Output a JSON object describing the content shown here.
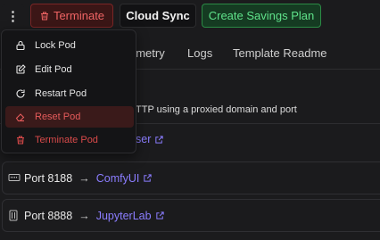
{
  "toolbar": {
    "kebab_symbol": "⋮",
    "terminate_label": "Terminate",
    "cloud_sync_label": "Cloud Sync",
    "savings_label": "Create Savings Plan"
  },
  "tabs": [
    {
      "label": "emetry"
    },
    {
      "label": "Logs"
    },
    {
      "label": "Template Readme"
    }
  ],
  "info_text": "TTP using a proxied domain and port",
  "partial_link": "ser",
  "ports": [
    {
      "label": "Port 8188",
      "arrow": "→",
      "link": "ComfyUI",
      "icon": "port-icon"
    },
    {
      "label": "Port 8888",
      "arrow": "→",
      "link": "JupyterLab",
      "icon": "port-icon"
    }
  ],
  "menu": {
    "items": [
      {
        "label": "Lock Pod",
        "icon": "lock-icon",
        "variant": "normal"
      },
      {
        "label": "Edit Pod",
        "icon": "edit-icon",
        "variant": "normal"
      },
      {
        "label": "Restart Pod",
        "icon": "restart-icon",
        "variant": "normal"
      },
      {
        "label": "Reset Pod",
        "icon": "eraser-icon",
        "variant": "danger-active"
      },
      {
        "label": "Terminate Pod",
        "icon": "trash-icon",
        "variant": "danger"
      }
    ]
  },
  "colors": {
    "accent_link": "#8b7dff",
    "danger": "#d94a4a",
    "success": "#5fe28a"
  }
}
